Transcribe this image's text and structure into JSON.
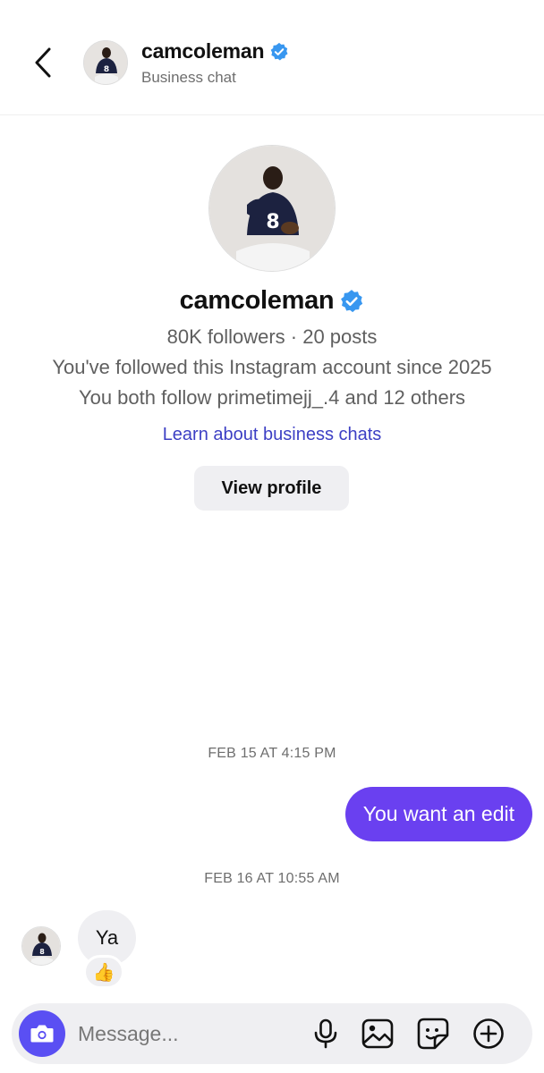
{
  "header": {
    "username": "camcoleman",
    "subtitle": "Business chat"
  },
  "profile": {
    "username": "camcoleman",
    "stats": "80K followers · 20 posts",
    "follow_since": "You've followed this Instagram account since 2025",
    "mutuals": "You both follow primetimejj_.4 and 12 others",
    "learn_link": "Learn about business chats",
    "view_profile_label": "View profile",
    "jersey_number": "8"
  },
  "chat": {
    "messages": [
      {
        "timestamp": "FEB 15 AT 4:15 PM",
        "sender": "me",
        "text": "You want an edit"
      },
      {
        "timestamp": "FEB 16 AT 10:55 AM",
        "sender": "them",
        "text": "Ya",
        "reaction": "👍"
      }
    ]
  },
  "composer": {
    "placeholder": "Message..."
  },
  "icons": {
    "back": "chevron-left-icon",
    "verified": "verified-badge-icon",
    "camera": "camera-icon",
    "mic": "microphone-icon",
    "gallery": "image-icon",
    "sticker": "sticker-icon",
    "plus": "plus-circle-icon"
  },
  "colors": {
    "accent": "#6a40f0",
    "camera_button": "#5a4ff3",
    "verified": "#3897f0",
    "link": "#3c3fc4",
    "bubble_gray": "#efeff2"
  }
}
